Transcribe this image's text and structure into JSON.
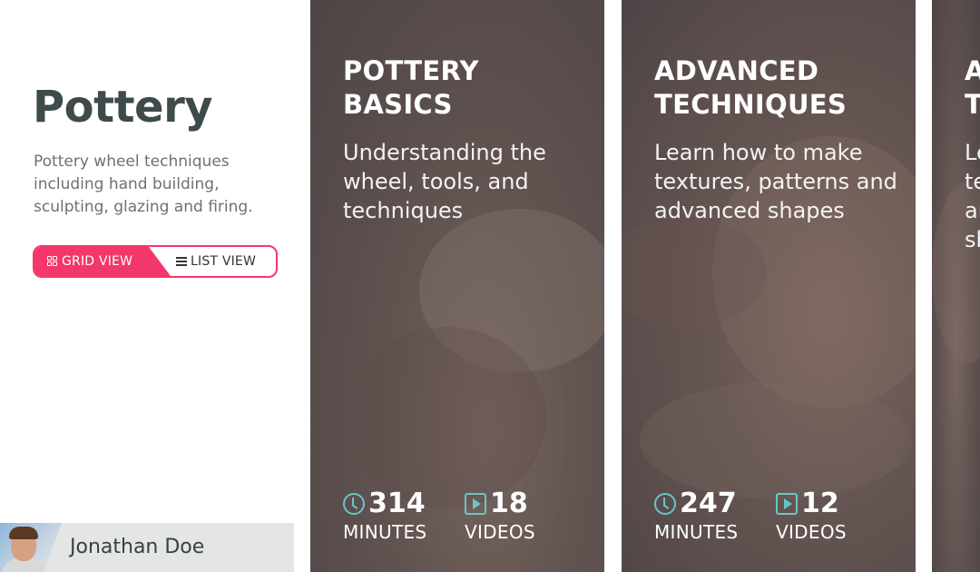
{
  "sidebar": {
    "title": "Pottery",
    "description": "Pottery wheel techniques including hand building, sculpting, glazing and firing.",
    "view_toggle": {
      "grid_label": "GRID VIEW",
      "list_label": "LIST VIEW",
      "active": "grid",
      "accent_color": "#f4376b"
    }
  },
  "user": {
    "name": "Jonathan Doe"
  },
  "cards": [
    {
      "title": "POTTERY BASICS",
      "subtitle": "Understanding the wheel, tools, and techniques",
      "minutes": "314",
      "minutes_label": "MINUTES",
      "videos": "18",
      "videos_label": "VIDEOS"
    },
    {
      "title": "ADVANCED TECHNIQUES",
      "subtitle": "Learn how to make textures, patterns and advanced shapes",
      "minutes": "247",
      "minutes_label": "MINUTES",
      "videos": "12",
      "videos_label": "VIDEOS"
    },
    {
      "title": "A T",
      "subtitle": "Le te ar sh"
    }
  ],
  "icons": {
    "minutes": "clock-icon",
    "videos": "play-icon",
    "grid": "grid-icon",
    "list": "list-icon",
    "stat_color": "#66c7c9"
  }
}
